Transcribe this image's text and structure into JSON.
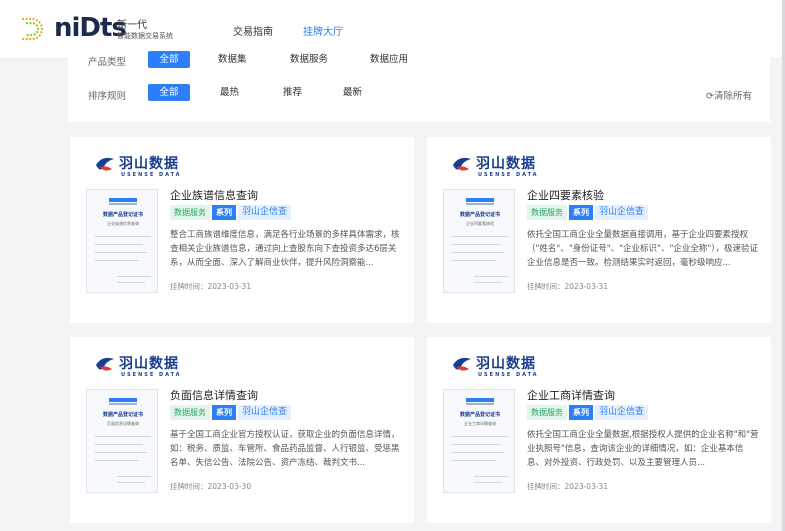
{
  "header": {
    "logo_main": "niDts",
    "logo_sub1": "新一代",
    "logo_sub2": "智能数据交易系统",
    "nav": [
      {
        "label": "交易指南",
        "active": false
      },
      {
        "label": "挂牌大厅",
        "active": true
      }
    ]
  },
  "filters": {
    "product_type_label": "产品类型",
    "product_types": [
      "全部",
      "数据集",
      "数据服务",
      "数据应用"
    ],
    "sort_label": "排序规则",
    "sorts": [
      "全部",
      "最热",
      "推荐",
      "最新"
    ],
    "clear_all": "⟳清除所有"
  },
  "brand": {
    "cn": "羽山数据",
    "en": "USENSE DATA"
  },
  "thumb": {
    "title": "数据产品登记证书"
  },
  "cards": [
    {
      "title": "企业族谱信息查询",
      "tags": [
        "数据服务",
        "系列",
        "羽山企信查"
      ],
      "description": "整合工商族谱维度信息，满足各行业场景的多样具体需求，核查相关企业族谱信息，通过向上查股东向下查投资多达6层关系，从而全面、深入了解商业伙伴，提升风险洞察能...",
      "time": "挂牌时间：2023-03-31",
      "thumb_sub": "企业族谱信息查询"
    },
    {
      "title": "企业四要素核验",
      "tags": [
        "数据服务",
        "系列",
        "羽山企信查"
      ],
      "description": "依托全国工商企业全量数据直接调用，基于企业四要素授权（\"姓名\"、\"身份证号\"、\"企业标识\"、\"企业全称\"），极速验证企业信息是否一致。检测结果实时返回，毫秒级响应...",
      "time": "挂牌时间：2023-03-31",
      "thumb_sub": "企业四要素核验"
    },
    {
      "title": "负面信息详情查询",
      "tags": [
        "数据服务",
        "系列",
        "羽山企信查"
      ],
      "description": "基于全国工商企业官方授权认证，获取企业的负面信息详情，如：税务、质监、车管所、食品药品监督、人行银监、受惩黑名单、失信公告、法院公告、资产冻结、裁判文书...",
      "time": "挂牌时间：2023-03-30",
      "thumb_sub": "负面信息详情查询"
    },
    {
      "title": "企业工商详情查询",
      "tags": [
        "数据服务",
        "系列",
        "羽山企信查"
      ],
      "description": "依托全国工商企业全量数据,根据授权人提供的企业名称\"和\"营业执照号\"信息，查询该企业的详细情况，如：企业基本信息、对外投资、行政处罚、以及主要管理人员...",
      "time": "挂牌时间：2023-03-31",
      "thumb_sub": "企业工商详情查询"
    }
  ]
}
